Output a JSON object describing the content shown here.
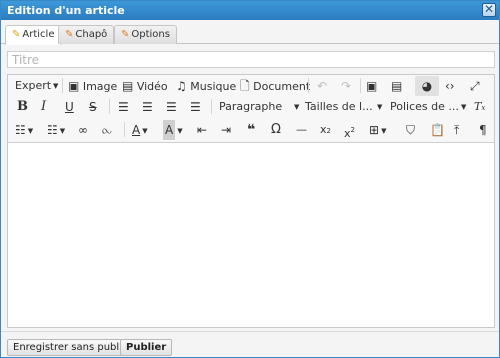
{
  "dialog": {
    "title": "Edition d'un article",
    "close_glyph": "✕"
  },
  "tabs": [
    {
      "label": "Article",
      "icon": "pencil-icon"
    },
    {
      "label": "Chapô",
      "icon": "pencil-icon"
    },
    {
      "label": "Options",
      "icon": "pencil-icon"
    }
  ],
  "title_field": {
    "placeholder": "Titre",
    "value": ""
  },
  "toolbar": {
    "expert_label": "Expert",
    "image_label": "Image",
    "video_label": "Vidéo",
    "music_label": "Musique",
    "document_label": "Document",
    "format_label": "Paragraphe",
    "font_size_label": "Tailles de l...",
    "font_family_label": "Polices de ..."
  },
  "footer": {
    "save_draft_label": "Enregistrer sans publier",
    "publish_label": "Publier"
  },
  "colors": {
    "titlebar": "#2b7cc0",
    "accent": "#3a87c5"
  }
}
